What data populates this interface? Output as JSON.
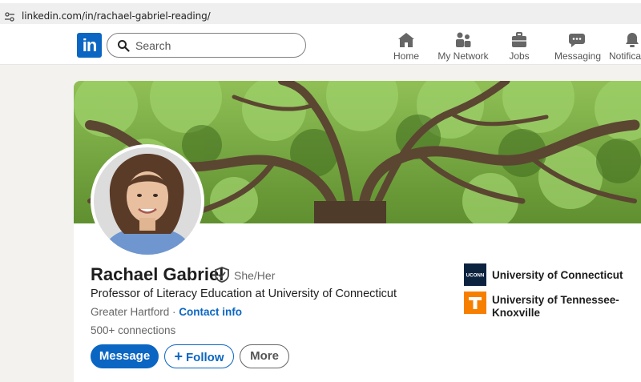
{
  "browser": {
    "url": "linkedin.com/in/rachael-gabriel-reading/"
  },
  "nav": {
    "logo": "in",
    "search_placeholder": "Search",
    "items": [
      {
        "label": "Home",
        "icon": "home-icon"
      },
      {
        "label": "My Network",
        "icon": "network-icon"
      },
      {
        "label": "Jobs",
        "icon": "briefcase-icon"
      },
      {
        "label": "Messaging",
        "icon": "messaging-icon"
      },
      {
        "label": "Notifications",
        "icon": "bell-icon"
      }
    ]
  },
  "profile": {
    "name": "Rachael Gabriel",
    "pronouns": "She/Her",
    "headline": "Professor of Literacy Education at University of Connecticut",
    "location": "Greater Hartford",
    "location_sep": " · ",
    "contact_link": "Contact info",
    "connections": "500+ connections"
  },
  "actions": {
    "message": "Message",
    "follow": "Follow",
    "more": "More"
  },
  "education": [
    {
      "name": "University of Connecticut",
      "logo_text": "UCONN",
      "logo_color": "#0c2340"
    },
    {
      "name": "University of Tennessee-Knoxville",
      "logo_text": "T",
      "logo_color": "#f77f00"
    }
  ],
  "colors": {
    "brand": "#0a66c2",
    "background": "#f4f2ee"
  }
}
